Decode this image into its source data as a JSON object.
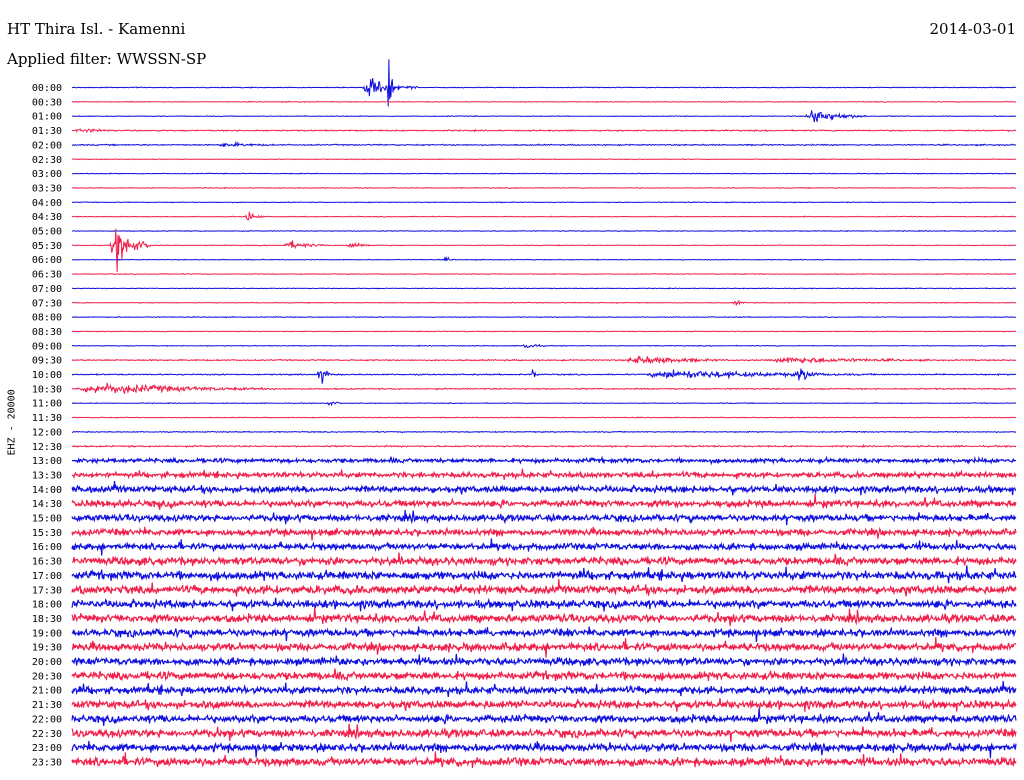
{
  "header": {
    "station": "HT Thira Isl. - Kamenni",
    "date": "2014-03-01",
    "filter": "Applied filter: WWSSN-SP"
  },
  "side_label": "EHZ - 20000",
  "colors": {
    "blue": "#1010e0",
    "red": "#f0204a"
  },
  "chart_data": {
    "type": "line",
    "title": "",
    "xlabel": "",
    "ylabel": "EHZ - 20000",
    "xlim": [
      0,
      30
    ],
    "x_unit": "minutes within row",
    "row_labels": [
      "00:00",
      "00:30",
      "01:00",
      "01:30",
      "02:00",
      "02:30",
      "03:00",
      "03:30",
      "04:00",
      "04:30",
      "05:00",
      "05:30",
      "06:00",
      "06:30",
      "07:00",
      "07:30",
      "08:00",
      "08:30",
      "09:00",
      "09:30",
      "10:00",
      "10:30",
      "11:00",
      "11:30",
      "12:00",
      "12:30",
      "13:00",
      "13:30",
      "14:00",
      "14:30",
      "15:00",
      "15:30",
      "16:00",
      "16:30",
      "17:00",
      "17:30",
      "18:00",
      "18:30",
      "19:00",
      "19:30",
      "20:00",
      "20:30",
      "21:00",
      "21:30",
      "22:00",
      "22:30",
      "23:00",
      "23:30"
    ],
    "row_colors": [
      "blue",
      "red",
      "blue",
      "red",
      "blue",
      "red",
      "blue",
      "red",
      "blue",
      "red",
      "blue",
      "red",
      "blue",
      "red",
      "blue",
      "red",
      "blue",
      "red",
      "blue",
      "red",
      "blue",
      "red",
      "blue",
      "red",
      "blue",
      "red",
      "blue",
      "red",
      "blue",
      "red",
      "blue",
      "red",
      "blue",
      "red",
      "blue",
      "red",
      "blue",
      "red",
      "blue",
      "red",
      "blue",
      "red",
      "blue",
      "red",
      "blue",
      "red",
      "blue",
      "red"
    ],
    "noise_amplitude": [
      0.3,
      0.3,
      0.3,
      0.5,
      0.5,
      0.3,
      0.3,
      0.3,
      0.3,
      0.3,
      0.3,
      0.3,
      0.3,
      0.3,
      0.3,
      0.3,
      0.3,
      0.3,
      0.3,
      0.5,
      0.5,
      0.5,
      0.3,
      0.3,
      0.4,
      0.6,
      1.6,
      2.0,
      2.5,
      2.5,
      2.5,
      2.5,
      2.5,
      3.0,
      3.2,
      3.2,
      3.0,
      3.0,
      2.8,
      3.0,
      2.8,
      3.0,
      2.8,
      3.0,
      2.8,
      3.0,
      3.0,
      3.2
    ],
    "events": [
      {
        "row": "00:00",
        "start": 9.2,
        "duration": 1.8,
        "amplitude": 8
      },
      {
        "row": "00:00",
        "start": 10.0,
        "duration": 0.4,
        "amplitude": 22
      },
      {
        "row": "01:00",
        "start": 23.3,
        "duration": 2.0,
        "amplitude": 7
      },
      {
        "row": "01:30",
        "start": 0.0,
        "duration": 2.4,
        "amplitude": 2
      },
      {
        "row": "02:00",
        "start": 4.5,
        "duration": 3.0,
        "amplitude": 2
      },
      {
        "row": "04:30",
        "start": 5.5,
        "duration": 0.6,
        "amplitude": 6
      },
      {
        "row": "05:30",
        "start": 1.2,
        "duration": 1.3,
        "amplitude": 18
      },
      {
        "row": "05:30",
        "start": 6.7,
        "duration": 1.5,
        "amplitude": 4
      },
      {
        "row": "05:30",
        "start": 8.7,
        "duration": 1.2,
        "amplitude": 3
      },
      {
        "row": "06:00",
        "start": 11.8,
        "duration": 0.5,
        "amplitude": 2
      },
      {
        "row": "07:30",
        "start": 21.0,
        "duration": 0.5,
        "amplitude": 3
      },
      {
        "row": "09:00",
        "start": 14.3,
        "duration": 0.8,
        "amplitude": 4
      },
      {
        "row": "09:30",
        "start": 17.5,
        "duration": 4.0,
        "amplitude": 4
      },
      {
        "row": "09:30",
        "start": 22.0,
        "duration": 7.0,
        "amplitude": 3
      },
      {
        "row": "10:00",
        "start": 7.8,
        "duration": 0.5,
        "amplitude": 10
      },
      {
        "row": "10:00",
        "start": 14.6,
        "duration": 0.3,
        "amplitude": 5
      },
      {
        "row": "10:00",
        "start": 18.0,
        "duration": 9.0,
        "amplitude": 4
      },
      {
        "row": "10:00",
        "start": 23.0,
        "duration": 1.0,
        "amplitude": 7
      },
      {
        "row": "10:30",
        "start": 0.0,
        "duration": 7.5,
        "amplitude": 5
      },
      {
        "row": "11:00",
        "start": 8.0,
        "duration": 1.0,
        "amplitude": 2
      },
      {
        "row": "18:30",
        "start": 21.0,
        "duration": 0.5,
        "amplitude": 8
      }
    ]
  }
}
